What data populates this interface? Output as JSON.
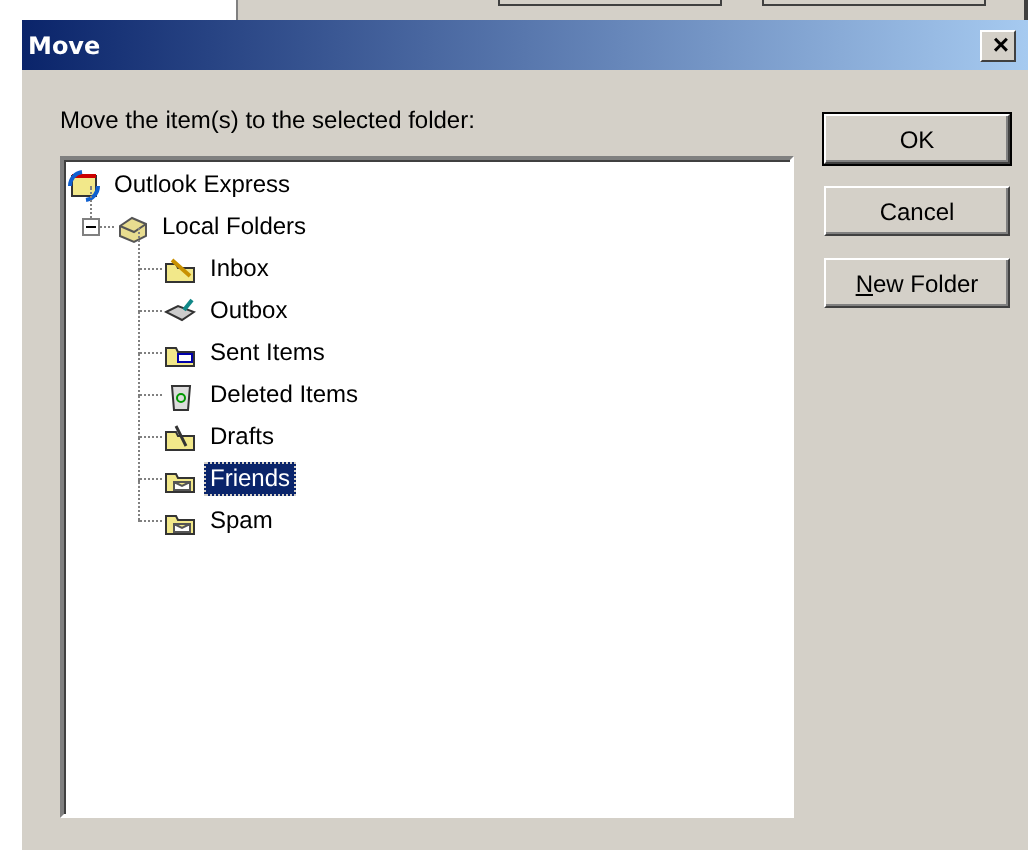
{
  "window": {
    "title": "Move",
    "close": "×"
  },
  "prompt": "Move the item(s) to the selected folder:",
  "tree": [
    {
      "label": "Outlook Express",
      "kind": "root",
      "selected": false,
      "children": [
        {
          "label": "Local Folders",
          "kind": "store",
          "selected": false,
          "expanded": true,
          "children": [
            {
              "label": "Inbox",
              "kind": "inbox",
              "selected": false
            },
            {
              "label": "Outbox",
              "kind": "outbox",
              "selected": false
            },
            {
              "label": "Sent Items",
              "kind": "sent",
              "selected": false
            },
            {
              "label": "Deleted Items",
              "kind": "deleted",
              "selected": false
            },
            {
              "label": "Drafts",
              "kind": "drafts",
              "selected": false
            },
            {
              "label": "Friends",
              "kind": "folder",
              "selected": true
            },
            {
              "label": "Spam",
              "kind": "folder",
              "selected": false
            }
          ]
        }
      ]
    }
  ],
  "buttons": [
    {
      "label": "OK",
      "default": true,
      "underline_first": false
    },
    {
      "label": "Cancel",
      "default": false,
      "underline_first": false
    },
    {
      "label": "New Folder",
      "default": false,
      "underline_first": true
    }
  ]
}
